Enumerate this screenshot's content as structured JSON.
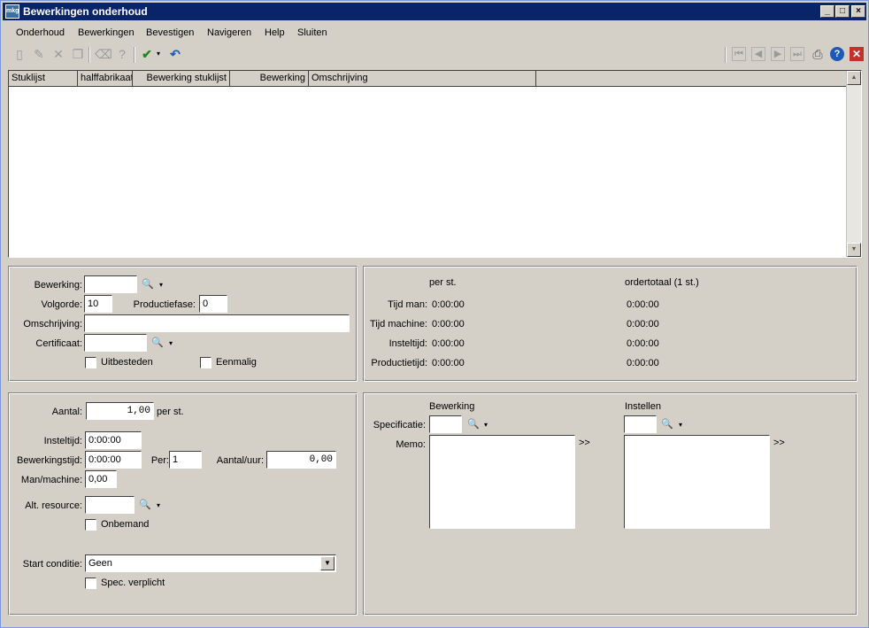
{
  "window": {
    "title": "Bewerkingen onderhoud",
    "app_icon": "mkg"
  },
  "menu": [
    "Onderhoud",
    "Bewerkingen",
    "Bevestigen",
    "Navigeren",
    "Help",
    "Sluiten"
  ],
  "grid": {
    "columns": [
      "Stuklijst",
      "halffabrikaat",
      "Bewerking stuklijst",
      "Bewerking",
      "Omschrijving"
    ]
  },
  "operation_panel": {
    "bewerking_label": "Bewerking:",
    "bewerking_value": "",
    "volgorde_label": "Volgorde:",
    "volgorde_value": "10",
    "productiefase_label": "Productiefase:",
    "productiefase_value": "0",
    "omschrijving_label": "Omschrijving:",
    "omschrijving_value": "",
    "certificaat_label": "Certificaat:",
    "certificaat_value": "",
    "uitbesteden_label": "Uitbesteden",
    "eenmalig_label": "Eenmalig"
  },
  "times_panel": {
    "col_per": "per st.",
    "col_total": "ordertotaal (1 st.)",
    "rows": [
      {
        "label": "Tijd man:",
        "per": "0:00:00",
        "total": "0:00:00"
      },
      {
        "label": "Tijd machine:",
        "per": "0:00:00",
        "total": "0:00:00"
      },
      {
        "label": "Insteltijd:",
        "per": "0:00:00",
        "total": "0:00:00"
      },
      {
        "label": "Productietijd:",
        "per": "0:00:00",
        "total": "0:00:00"
      }
    ]
  },
  "quantity_panel": {
    "aantal_label": "Aantal:",
    "aantal_value": "1,00",
    "aantal_unit": "per st.",
    "insteltijd_label": "Insteltijd:",
    "insteltijd_value": "0:00:00",
    "bewerkingstijd_label": "Bewerkingstijd:",
    "bewerkingstijd_value": "0:00:00",
    "per_label": "Per:",
    "per_value": "1",
    "aantal_uur_label": "Aantal/uur:",
    "aantal_uur_value": "0,00",
    "man_machine_label": "Man/machine:",
    "man_machine_value": "0,00",
    "alt_resource_label": "Alt. resource:",
    "alt_resource_value": "",
    "onbemand_label": "Onbemand",
    "start_conditie_label": "Start conditie:",
    "start_conditie_value": "Geen",
    "spec_verplicht_label": "Spec. verplicht"
  },
  "spec_panel": {
    "bewerking_header": "Bewerking",
    "instellen_header": "Instellen",
    "specificatie_label": "Specificatie:",
    "memo_label": "Memo:",
    "expand_label": ">>"
  }
}
